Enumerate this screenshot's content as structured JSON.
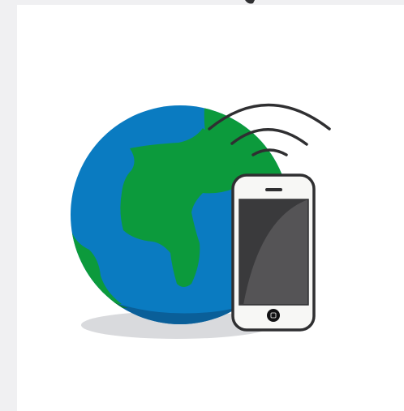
{
  "illustration": {
    "subject": "globe-with-smartphone",
    "colors": {
      "page_background": "#f0f0f2",
      "card_background": "#ffffff",
      "ocean": "#0a7bc1",
      "ocean_shadow": "#0a5f99",
      "land": "#0c9a3c",
      "land_shadow": "#0a7a30",
      "ground_shadow": "#d9dadd",
      "phone_body": "#f7f7f5",
      "phone_outline": "#2f2f31",
      "phone_screen": "#555456",
      "phone_screen_dark": "#3a3a3c",
      "signal_waves": "#2f2f31"
    },
    "icons": [
      "globe-icon",
      "smartphone-icon",
      "signal-waves-icon"
    ]
  }
}
